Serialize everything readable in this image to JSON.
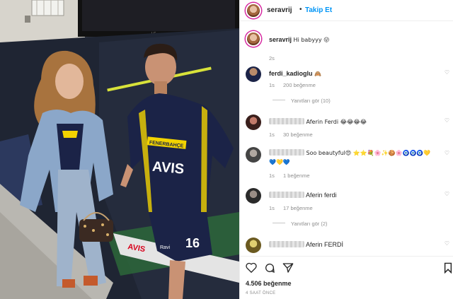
{
  "post": {
    "username": "seravrij",
    "follow_label": "Takip Et",
    "separator": "•",
    "caption_user": "seravrij",
    "caption_text": "Hi babyyy 😛",
    "caption_time": "2s"
  },
  "photo": {
    "brand_text": "FENERBAHÇE",
    "sponsor_text": "AVIS",
    "player_number": "16",
    "tv_brand": "LG",
    "avis_strip": "AVIS",
    "kit_badge": "Ravi"
  },
  "comments": [
    {
      "user": "ferdi_kadioglu",
      "text": "🙈",
      "time": "1s",
      "likes": "200 beğenme",
      "replies": "Yanıtları gör (10)"
    },
    {
      "user": "",
      "text": "Aferin Ferdi 😂😂😂😂",
      "time": "1s",
      "likes": "30 beğenme",
      "replies": ""
    },
    {
      "user": "",
      "text": "Soo beautyful😍 ⭐⭐💐🌸✨🍪🌸🧿🧿🧿💛",
      "text2": "💙💛💙",
      "time": "1s",
      "likes": "1 beğenme",
      "replies": ""
    },
    {
      "user": "",
      "text": "Aferin ferdi",
      "time": "1s",
      "likes": "17 beğenme",
      "replies": "Yanıtları gör (2)"
    },
    {
      "user": "",
      "text": "Aferin FERDİ",
      "time": "",
      "likes": "",
      "replies": ""
    }
  ],
  "actions": {
    "like_count": "4.506 beğenme",
    "posted_ago": "4 SAAT ÖNCE"
  },
  "colors": {
    "link_blue": "#0095f6",
    "text": "#262626",
    "muted": "#8e8e8e",
    "jersey_navy": "#1b2347",
    "jersey_yellow": "#f2d300"
  },
  "icons": [
    "heart-icon",
    "comment-icon",
    "share-icon",
    "bookmark-icon"
  ]
}
